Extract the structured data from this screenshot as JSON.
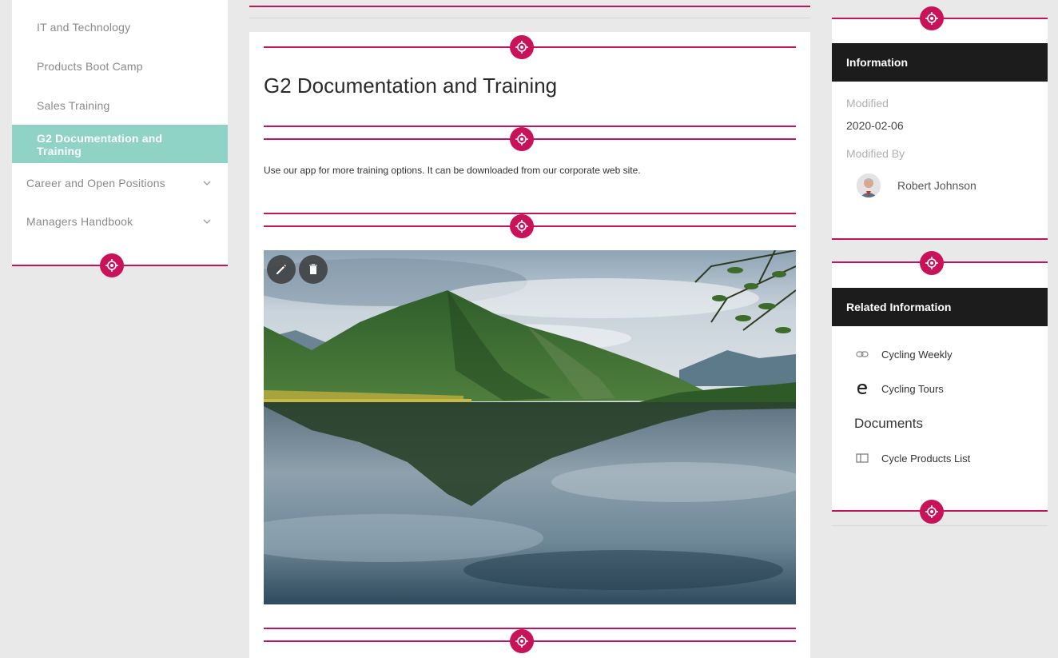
{
  "sidebar": {
    "items": [
      {
        "label": "IT and Technology"
      },
      {
        "label": "Products Boot Camp"
      },
      {
        "label": "Sales Training"
      },
      {
        "label": "G2 Documentation and Training"
      },
      {
        "label": "Career and Open Positions"
      },
      {
        "label": "Managers Handbook"
      }
    ]
  },
  "main": {
    "title": "G2 Documentation and Training",
    "body": "Use our app for more training options. It can be downloaded from our corporate web site.",
    "image_alt": "lake-mountain-landscape"
  },
  "info": {
    "header": "Information",
    "modified_label": "Modified",
    "modified_value": "2020-02-06",
    "modified_by_label": "Modified By",
    "modified_by_value": "Robert Johnson"
  },
  "related": {
    "header": "Related Information",
    "links": [
      {
        "label": "Cycling Weekly",
        "icon": "link-icon"
      },
      {
        "label": "Cycling Tours",
        "icon": "edge-icon"
      }
    ],
    "documents_title": "Documents",
    "documents": [
      {
        "label": "Cycle Products List",
        "icon": "document-icon"
      }
    ]
  },
  "colors": {
    "accent": "#c8135a",
    "active_nav": "#8fd3c6",
    "card_header": "#1c1c1c"
  }
}
